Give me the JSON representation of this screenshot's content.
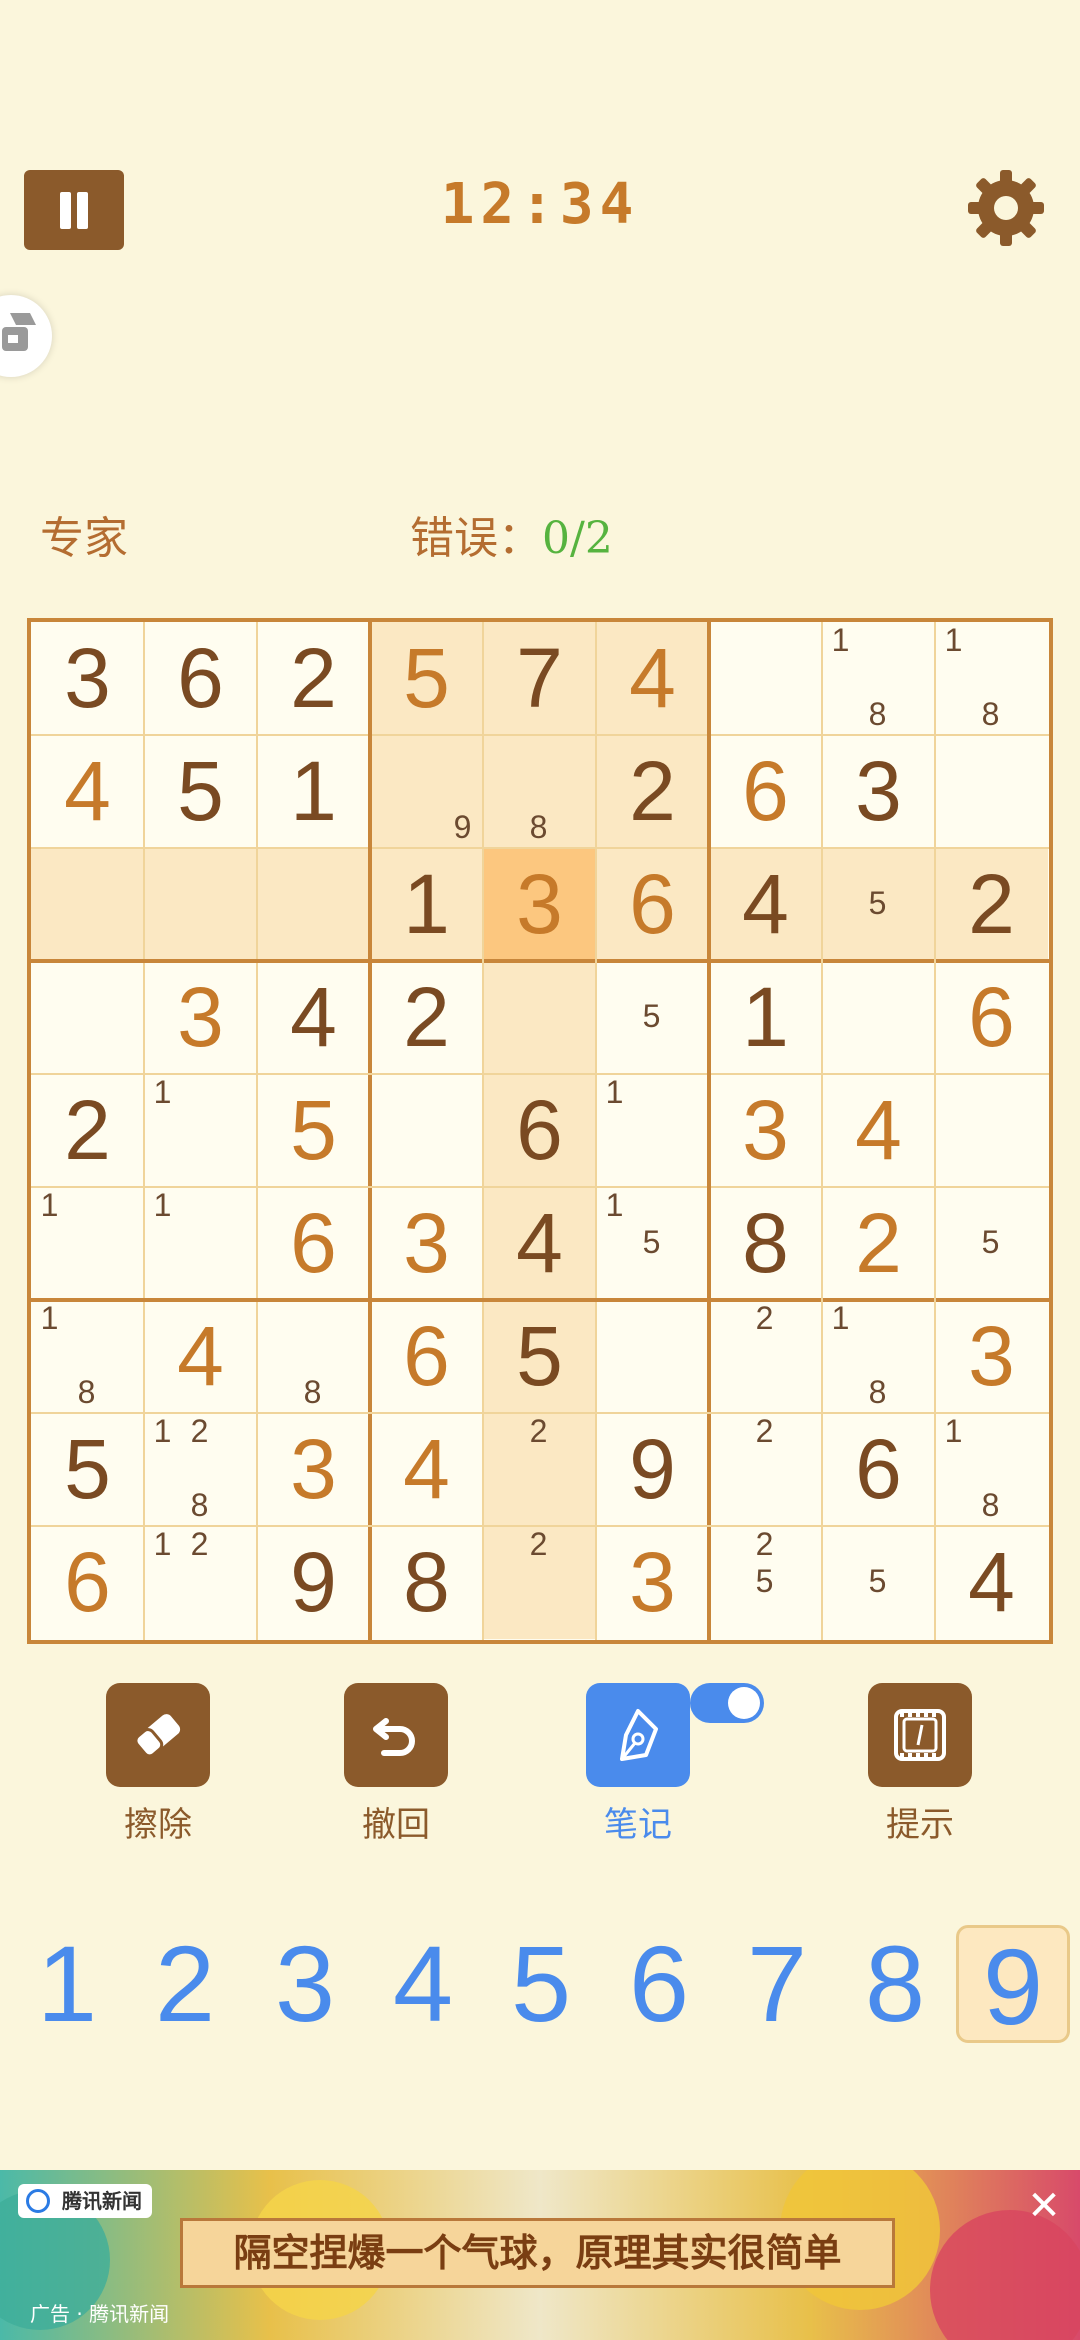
{
  "header": {
    "timer": "12:34"
  },
  "info": {
    "difficulty": "专家",
    "errors_label": "错误：",
    "errors_count": "0/2"
  },
  "board": {
    "rows": [
      [
        {
          "v": "3",
          "t": "g"
        },
        {
          "v": "6",
          "t": "g"
        },
        {
          "v": "2",
          "t": "g"
        },
        {
          "v": "5",
          "t": "u"
        },
        {
          "v": "7",
          "t": "g"
        },
        {
          "v": "4",
          "t": "u"
        },
        {
          "v": "",
          "n": []
        },
        {
          "v": "",
          "n": [
            "1",
            "8"
          ]
        },
        {
          "v": "",
          "n": [
            "1",
            "8"
          ]
        }
      ],
      [
        {
          "v": "4",
          "t": "u"
        },
        {
          "v": "5",
          "t": "g"
        },
        {
          "v": "1",
          "t": "g"
        },
        {
          "v": "",
          "n": [
            "9"
          ]
        },
        {
          "v": "",
          "n": [
            "8"
          ]
        },
        {
          "v": "2",
          "t": "g"
        },
        {
          "v": "6",
          "t": "u"
        },
        {
          "v": "3",
          "t": "g"
        },
        {
          "v": "",
          "n": []
        }
      ],
      [
        {
          "v": "",
          "n": []
        },
        {
          "v": "",
          "n": []
        },
        {
          "v": "",
          "n": []
        },
        {
          "v": "1",
          "t": "g"
        },
        {
          "v": "3",
          "t": "u"
        },
        {
          "v": "6",
          "t": "u"
        },
        {
          "v": "4",
          "t": "g"
        },
        {
          "v": "",
          "n": [
            "5"
          ]
        },
        {
          "v": "2",
          "t": "g"
        }
      ],
      [
        {
          "v": "",
          "n": []
        },
        {
          "v": "3",
          "t": "u"
        },
        {
          "v": "4",
          "t": "g"
        },
        {
          "v": "2",
          "t": "g"
        },
        {
          "v": "",
          "n": []
        },
        {
          "v": "",
          "n": [
            "5"
          ]
        },
        {
          "v": "1",
          "t": "g"
        },
        {
          "v": "",
          "n": []
        },
        {
          "v": "6",
          "t": "u"
        }
      ],
      [
        {
          "v": "2",
          "t": "g"
        },
        {
          "v": "",
          "n": [
            "1"
          ]
        },
        {
          "v": "5",
          "t": "u"
        },
        {
          "v": "",
          "n": []
        },
        {
          "v": "6",
          "t": "g"
        },
        {
          "v": "",
          "n": [
            "1"
          ]
        },
        {
          "v": "3",
          "t": "u"
        },
        {
          "v": "4",
          "t": "u"
        },
        {
          "v": "",
          "n": []
        }
      ],
      [
        {
          "v": "",
          "n": [
            "1"
          ]
        },
        {
          "v": "",
          "n": [
            "1"
          ]
        },
        {
          "v": "6",
          "t": "u"
        },
        {
          "v": "3",
          "t": "u"
        },
        {
          "v": "4",
          "t": "g"
        },
        {
          "v": "",
          "n": [
            "1",
            "5"
          ]
        },
        {
          "v": "8",
          "t": "g"
        },
        {
          "v": "2",
          "t": "u"
        },
        {
          "v": "",
          "n": [
            "5"
          ]
        }
      ],
      [
        {
          "v": "",
          "n": [
            "1",
            "8"
          ]
        },
        {
          "v": "4",
          "t": "u"
        },
        {
          "v": "",
          "n": [
            "8"
          ]
        },
        {
          "v": "6",
          "t": "u"
        },
        {
          "v": "5",
          "t": "g"
        },
        {
          "v": "",
          "n": []
        },
        {
          "v": "",
          "n": [
            "2"
          ]
        },
        {
          "v": "",
          "n": [
            "1",
            "8"
          ]
        },
        {
          "v": "3",
          "t": "u"
        }
      ],
      [
        {
          "v": "5",
          "t": "g"
        },
        {
          "v": "",
          "n": [
            "1",
            "2",
            "8"
          ]
        },
        {
          "v": "3",
          "t": "u"
        },
        {
          "v": "4",
          "t": "u"
        },
        {
          "v": "",
          "n": [
            "2"
          ]
        },
        {
          "v": "9",
          "t": "g"
        },
        {
          "v": "",
          "n": [
            "2"
          ]
        },
        {
          "v": "6",
          "t": "g"
        },
        {
          "v": "",
          "n": [
            "1",
            "8"
          ]
        }
      ],
      [
        {
          "v": "6",
          "t": "u"
        },
        {
          "v": "",
          "n": [
            "1",
            "2"
          ]
        },
        {
          "v": "9",
          "t": "g"
        },
        {
          "v": "8",
          "t": "g"
        },
        {
          "v": "",
          "n": [
            "2"
          ]
        },
        {
          "v": "3",
          "t": "u"
        },
        {
          "v": "",
          "n": [
            "2",
            "5"
          ]
        },
        {
          "v": "",
          "n": [
            "5"
          ]
        },
        {
          "v": "4",
          "t": "g"
        }
      ]
    ],
    "selected": {
      "row": 2,
      "col": 4
    }
  },
  "tools": [
    {
      "name": "erase",
      "label": "擦除",
      "icon": "eraser-icon"
    },
    {
      "name": "undo",
      "label": "撤回",
      "icon": "undo-icon"
    },
    {
      "name": "notes",
      "label": "笔记",
      "icon": "pen-icon",
      "active": true
    },
    {
      "name": "hint",
      "label": "提示",
      "icon": "hint-video-icon"
    }
  ],
  "notes_toggle": true,
  "numpad": [
    "1",
    "2",
    "3",
    "4",
    "5",
    "6",
    "7",
    "8",
    "9"
  ],
  "numpad_selected": "9",
  "ad": {
    "source": "腾讯新闻",
    "headline": "隔空捏爆一个气球，原理其实很简单",
    "label": "广告 · 腾讯新闻",
    "close": "✕"
  },
  "colors": {
    "background": "#fbf6dc",
    "brown": "#8b5a2b",
    "accent_blue": "#4a8bec",
    "given": "#7a4a22",
    "user": "#c67a2a"
  }
}
